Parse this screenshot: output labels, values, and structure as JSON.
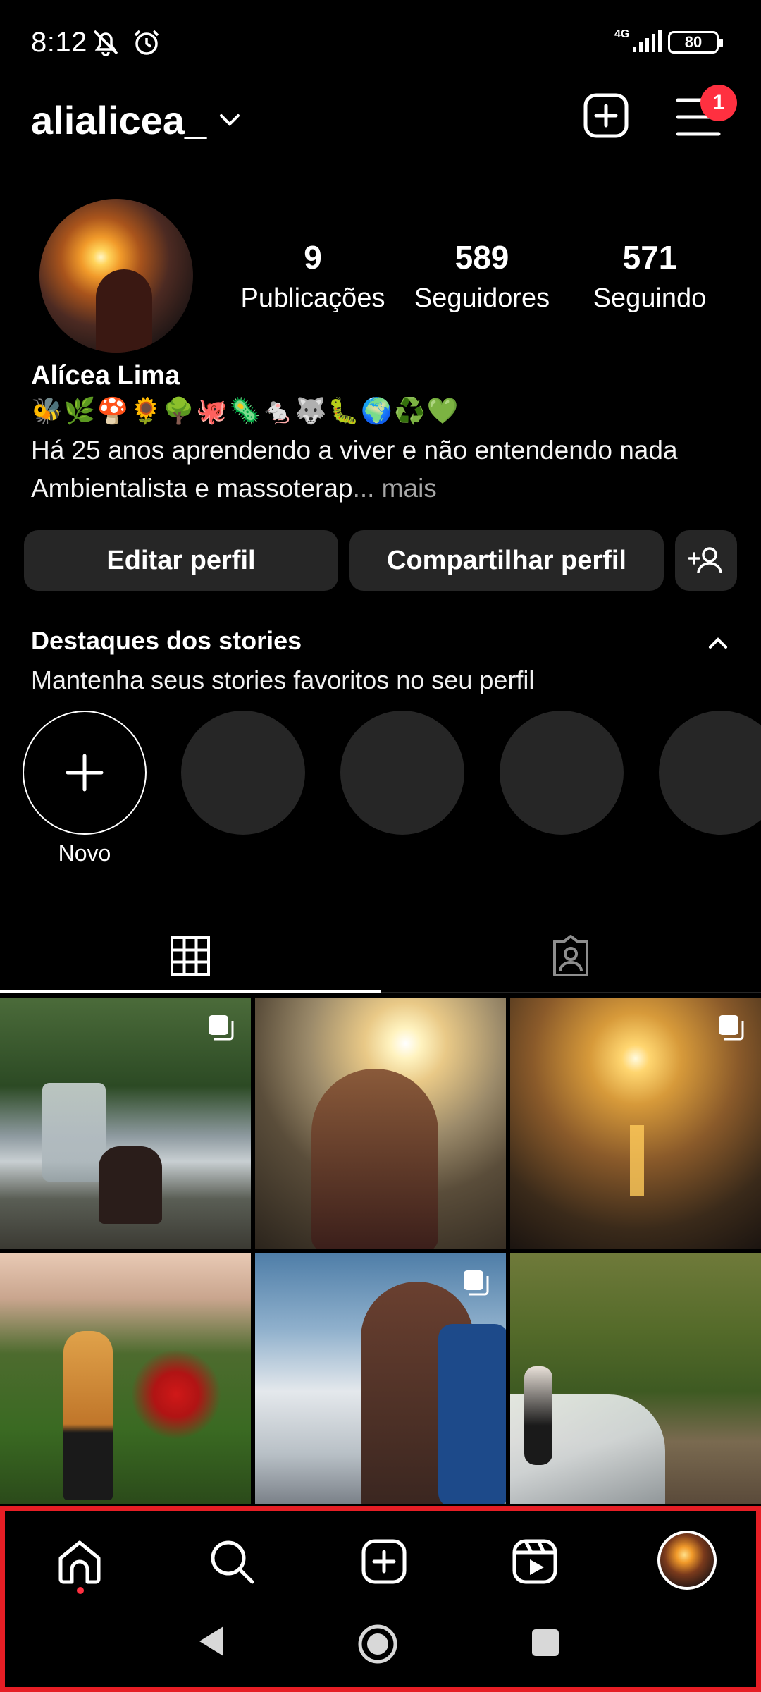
{
  "status_bar": {
    "time": "8:12",
    "network": "4G",
    "battery": "80"
  },
  "header": {
    "username": "alialicea_",
    "notification_count": "1"
  },
  "profile": {
    "stats": [
      {
        "value": "9",
        "label": "Publicações"
      },
      {
        "value": "589",
        "label": "Seguidores"
      },
      {
        "value": "571",
        "label": "Seguindo"
      }
    ],
    "full_name": "Alícea Lima",
    "emojis": "🐝🌿🍄🌻🌳🐙🦠🐁🐺🐛🌍♻️💚",
    "bio_line1": "Há 25 anos aprendendo a viver e não entendendo nada",
    "bio_line2": "Ambientalista e massoterap",
    "bio_more": "... mais"
  },
  "actions": {
    "edit_profile": "Editar perfil",
    "share_profile": "Compartilhar perfil"
  },
  "highlights": {
    "title": "Destaques dos stories",
    "subtitle": "Mantenha seus stories favoritos no seu perfil",
    "new_label": "Novo"
  },
  "colors": {
    "background": "#000000",
    "button_bg": "#262626",
    "badge": "#ff3040",
    "highlight_box": "#e61e25"
  },
  "icons": {
    "header": [
      "chevron-down-icon",
      "add-post-icon",
      "menu-icon"
    ],
    "tabs": [
      "grid-icon",
      "tagged-icon"
    ],
    "nav": [
      "home-icon",
      "search-icon",
      "create-icon",
      "reels-icon",
      "profile-avatar"
    ],
    "system": [
      "back-icon",
      "home-circle-icon",
      "recents-icon"
    ]
  }
}
